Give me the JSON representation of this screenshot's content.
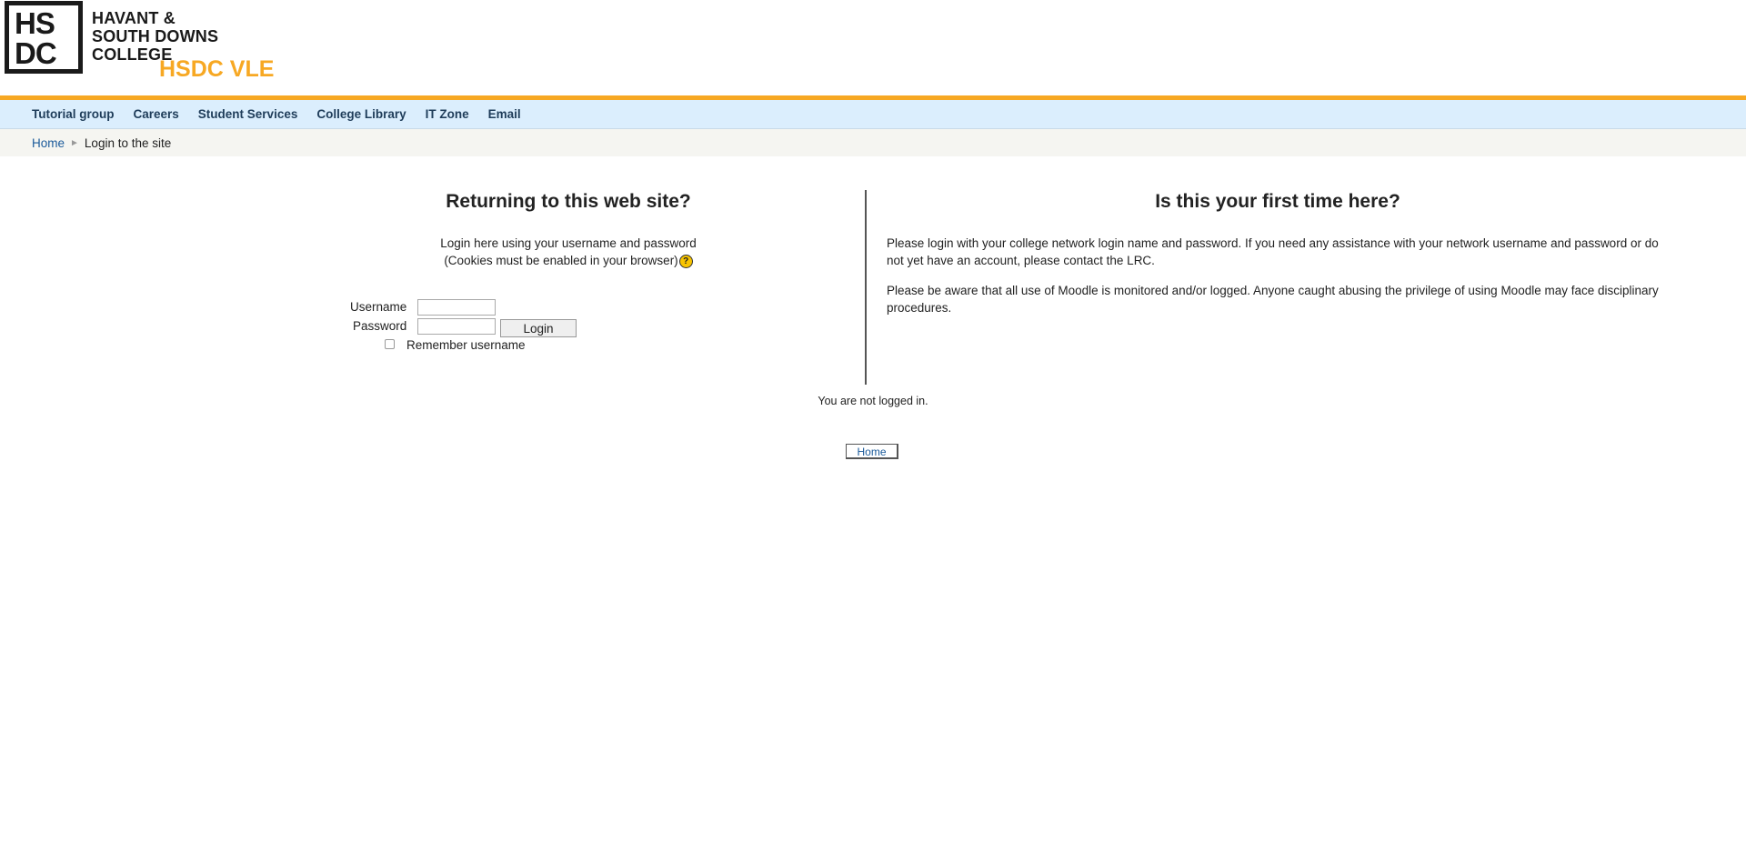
{
  "header": {
    "logo_line1": "HS",
    "logo_line2": "DC",
    "college_name_lines": [
      "HAVANT &",
      "SOUTH DOWNS",
      "COLLEGE"
    ],
    "site_title": "HSDC VLE"
  },
  "nav": {
    "items": [
      "Tutorial group",
      "Careers",
      "Student Services",
      "College Library",
      "IT Zone",
      "Email"
    ]
  },
  "breadcrumb": {
    "home": "Home",
    "separator": "►",
    "current": "Login to the site"
  },
  "login": {
    "heading": "Returning to this web site?",
    "desc_line1": "Login here using your username and password",
    "desc_line2": "(Cookies must be enabled in your browser)",
    "help_icon": "?",
    "username_label": "Username",
    "password_label": "Password",
    "username_value": "",
    "password_value": "",
    "login_button": "Login",
    "remember_label": "Remember username",
    "remember_checked": false
  },
  "first_time": {
    "heading": "Is this your first time here?",
    "para1": "Please login with your college network login name and password. If you need any assistance with your network username and password or do not yet have an account, please contact the LRC.",
    "para2": "Please be aware that all use of Moodle is monitored and/or logged. Anyone caught abusing the privilege of using Moodle may face disciplinary procedures."
  },
  "footer": {
    "status": "You are not logged in.",
    "home_link": "Home"
  },
  "colors": {
    "accent": "#f7a823",
    "nav_bg": "#dbeefd",
    "link": "#1a5a9a"
  }
}
